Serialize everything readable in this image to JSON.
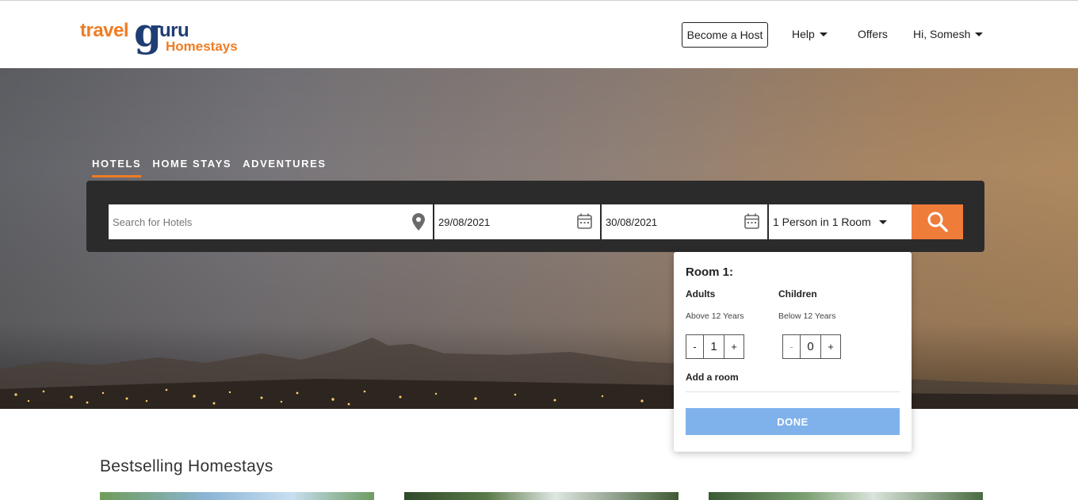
{
  "brand": {
    "part1": "travel",
    "part2": "g",
    "part3": "uru",
    "part4": "Homestays"
  },
  "nav": {
    "host_label": "Become a Host",
    "help_label": "Help",
    "offers_label": "Offers",
    "user_label": "Hi, Somesh"
  },
  "tabs": [
    {
      "label": "HOTELS",
      "active": true
    },
    {
      "label": "HOME STAYS",
      "active": false
    },
    {
      "label": "ADVENTURES",
      "active": false
    }
  ],
  "search": {
    "placeholder": "Search for Hotels",
    "checkin": "29/08/2021",
    "checkout": "30/08/2021",
    "guests": "1 Person in 1 Room"
  },
  "room_panel": {
    "title": "Room 1:",
    "adults_label": "Adults",
    "adults_sub": "Above 12 Years",
    "adults_value": "1",
    "children_label": "Children",
    "children_sub": "Below 12 Years",
    "children_value": "0",
    "minus": "-",
    "plus": "+",
    "add_room": "Add a room",
    "done_label": "DONE"
  },
  "section": {
    "title": "Bestselling Homestays"
  },
  "colors": {
    "accent": "#f07c22",
    "brand_blue": "#1f3d72",
    "done_button": "#7fb2eb",
    "search_button": "#f07c3a"
  }
}
